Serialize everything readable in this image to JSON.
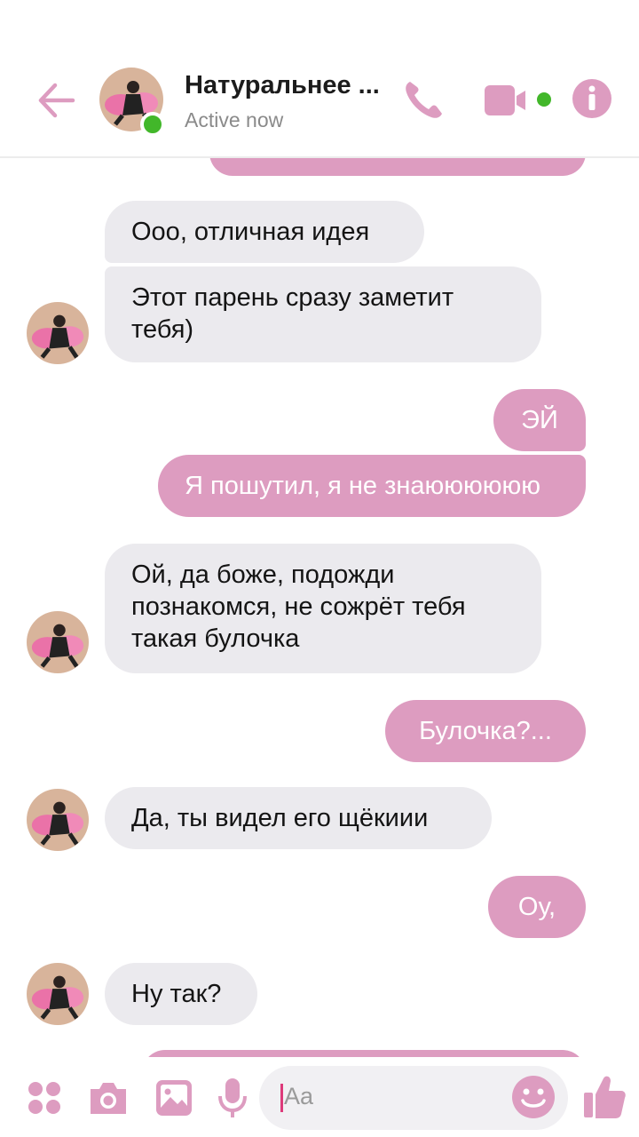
{
  "header": {
    "contact_name": "Натуральнее ...",
    "status": "Active now"
  },
  "messages": [
    {
      "dir": "out",
      "text": "",
      "partial": true
    },
    {
      "dir": "in",
      "text": "Ооо, отличная идея"
    },
    {
      "dir": "in",
      "text": "Этот парень сразу заметит тебя)"
    },
    {
      "dir": "out",
      "text": "ЭЙ"
    },
    {
      "dir": "out",
      "text": "Я пошутил, я не знаюююююю"
    },
    {
      "dir": "in",
      "text": "Ой, да боже, подожди познакомся, не сожрёт тебя такая булочка"
    },
    {
      "dir": "out",
      "text": "Булочка?..."
    },
    {
      "dir": "in",
      "text": "Да, ты видел его щёкиии"
    },
    {
      "dir": "out",
      "text": "Оу,"
    },
    {
      "dir": "in",
      "text": "Ну так?"
    },
    {
      "dir": "out",
      "text": "",
      "partial": true
    }
  ],
  "composer": {
    "placeholder": "Aa"
  },
  "colors": {
    "accent": "#dd9cc0",
    "incoming_bubble": "#ebeaee",
    "online": "#42b72a"
  },
  "icons": [
    "back-arrow-icon",
    "phone-icon",
    "video-camera-icon",
    "info-icon",
    "apps-icon",
    "camera-icon",
    "image-icon",
    "microphone-icon",
    "emoji-icon",
    "thumbs-up-icon"
  ]
}
